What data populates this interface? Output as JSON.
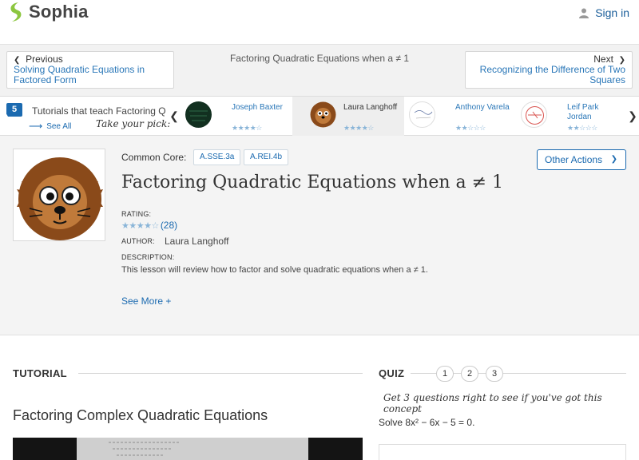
{
  "header": {
    "brand": "Sophia",
    "signin_label": "Sign in"
  },
  "nav": {
    "prev_label": "Previous",
    "prev_title": "Solving Quadratic Equations in Factored Form",
    "current_title": "Factoring Quadratic Equations when a ≠ 1",
    "next_label": "Next",
    "next_title": "Recognizing the Difference of Two Squares"
  },
  "tutorials": {
    "count": "5",
    "label": "Tutorials that teach Factoring Q",
    "see_all": "See All",
    "pick": "Take your pick:",
    "cards": [
      {
        "name": "Joseph Baxter",
        "rating": 4
      },
      {
        "name": "Laura Langhoff",
        "rating": 4
      },
      {
        "name": "Anthony Varela",
        "rating": 2
      },
      {
        "name": "Leif Park Jordan",
        "rating": 2
      }
    ]
  },
  "detail": {
    "common_core_label": "Common Core:",
    "common_core_tags": [
      "A.SSE.3a",
      "A.REI.4b"
    ],
    "other_actions": "Other Actions",
    "title": "Factoring Quadratic Equations when a ≠ 1",
    "rating_label": "RATING:",
    "rating_count": "(28)",
    "rating_value": 4,
    "author_label": "AUTHOR:",
    "author_name": "Laura Langhoff",
    "description_label": "DESCRIPTION:",
    "description": "This lesson will review how to factor and solve quadratic equations when a ≠ 1.",
    "see_more": "See More +"
  },
  "tutorial": {
    "heading": "TUTORIAL",
    "title": "Factoring Complex Quadratic Equations"
  },
  "quiz": {
    "heading": "QUIZ",
    "steps": [
      "1",
      "2",
      "3"
    ],
    "note": "Get 3 questions right to see if you've got this concept",
    "question_html": "Solve 8x² − 6x − 5 = 0."
  },
  "colors": {
    "accent": "#1b6ab0",
    "link": "#2a77b8",
    "brand_green": "#8cc63f",
    "star": "#8ab5d8"
  }
}
